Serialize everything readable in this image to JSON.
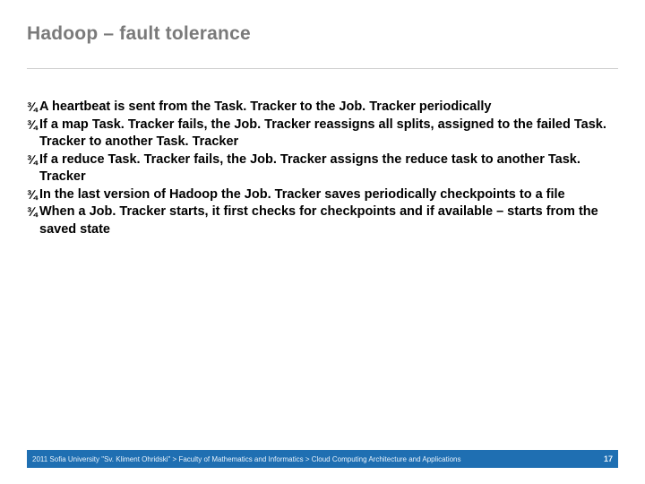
{
  "title": "Hadoop – fault tolerance",
  "bullets": [
    "A heartbeat is sent from the Task. Tracker to the Job. Tracker periodically",
    "If a map Task. Tracker fails, the Job. Tracker reassigns all splits, assigned to the failed Task. Tracker to another Task. Tracker",
    "If a reduce Task. Tracker fails, the Job. Tracker assigns the reduce task to another Task. Tracker",
    "In the last version of Hadoop the Job. Tracker saves periodically checkpoints to a file",
    "When a Job. Tracker starts, it first checks for checkpoints and if available – starts from the saved state"
  ],
  "bullet_glyph": "¾",
  "footer": {
    "left": "2011 Sofia University \"Sv. Kliment Ohridski\" > Faculty of Mathematics and Informatics > Cloud Computing Architecture and Applications",
    "page": "17"
  },
  "colors": {
    "title": "#7a7a7a",
    "footer_bg": "#1f6fb2"
  }
}
